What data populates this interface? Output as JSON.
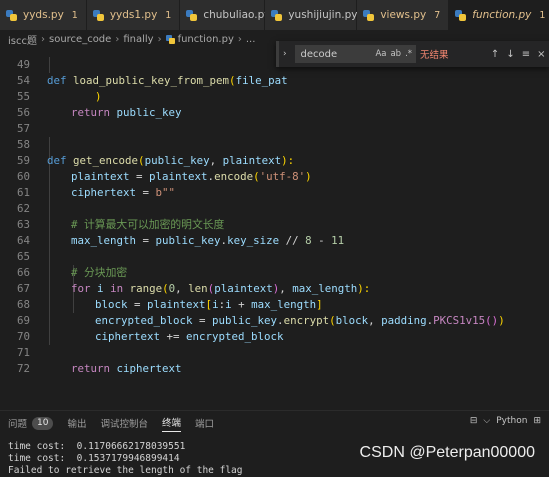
{
  "tabs": [
    {
      "name": "yyds.py",
      "badge": "1",
      "active": false
    },
    {
      "name": "yyds1.py",
      "badge": "1",
      "active": false
    },
    {
      "name": "chubuliao.py",
      "badge": "",
      "active": false
    },
    {
      "name": "yushijiujin.py",
      "badge": "",
      "active": false
    },
    {
      "name": "views.py",
      "badge": "7",
      "active": false
    },
    {
      "name": "function.py",
      "badge": "1",
      "active": true,
      "close": "×"
    }
  ],
  "breadcrumb": [
    "iscc题",
    "source_code",
    "finally",
    "function.py",
    "..."
  ],
  "find": {
    "query": "decode",
    "options": [
      "Aa",
      "ab",
      ".*"
    ],
    "status": "无结果",
    "buttons": [
      "↑",
      "↓",
      "≡",
      "×"
    ]
  },
  "code_lines": [
    {
      "n": "49",
      "indent": 0
    },
    {
      "n": "54",
      "indent": 1
    },
    {
      "n": "55",
      "indent": 1
    },
    {
      "n": "56",
      "indent": 0
    },
    {
      "n": "57",
      "indent": 0
    },
    {
      "n": "58",
      "indent": 0
    },
    {
      "n": "59",
      "indent": 1
    },
    {
      "n": "60",
      "indent": 1
    },
    {
      "n": "61",
      "indent": 1
    },
    {
      "n": "62",
      "indent": 1
    },
    {
      "n": "63",
      "indent": 1
    },
    {
      "n": "64",
      "indent": 1
    },
    {
      "n": "65",
      "indent": 1
    },
    {
      "n": "66",
      "indent": 1
    },
    {
      "n": "67",
      "indent": 2
    },
    {
      "n": "68",
      "indent": 2
    },
    {
      "n": "69",
      "indent": 2
    },
    {
      "n": "70",
      "indent": 1
    },
    {
      "n": "71",
      "indent": 1
    },
    {
      "n": "72",
      "indent": 0
    }
  ],
  "code_text": {
    "l49": [
      "def",
      "load_public_key_from_pem",
      "(",
      "file_pat"
    ],
    "l54": [
      ")"
    ],
    "l55": [
      "return",
      "public_key"
    ],
    "l58": [
      "def",
      "get_encode",
      "(",
      "public_key",
      ", ",
      "plaintext",
      "):"
    ],
    "l59": [
      "plaintext",
      " = ",
      "plaintext",
      ".",
      "encode",
      "(",
      "'utf-8'",
      ")"
    ],
    "l60": [
      "ciphertext",
      " = ",
      "b\"\""
    ],
    "l62": [
      "# 计算最大可以加密的明文长度"
    ],
    "l63": [
      "max_length",
      " = ",
      "public_key",
      ".",
      "key_size",
      " // ",
      "8",
      " - ",
      "11"
    ],
    "l65": [
      "# 分块加密"
    ],
    "l66": [
      "for",
      "i",
      "in",
      "range",
      "(",
      "0",
      ", ",
      "len",
      "(",
      "plaintext",
      ")",
      ", ",
      "max_length",
      "):"
    ],
    "l67": [
      "block",
      " = ",
      "plaintext",
      "[",
      "i",
      ":",
      "i",
      " + ",
      "max_length",
      "]"
    ],
    "l68": [
      "encrypted_block",
      " = ",
      "public_key",
      ".",
      "encrypt",
      "(",
      "block",
      ", ",
      "padding",
      ".",
      "PKCS1v15",
      "()",
      ")"
    ],
    "l69": [
      "ciphertext",
      " += ",
      "encrypted_block"
    ],
    "l71": [
      "return",
      "ciphertext"
    ]
  },
  "panel": {
    "tabs": [
      "问题",
      "输出",
      "调试控制台",
      "终端",
      "端口"
    ],
    "problems_count": "10",
    "active_tab": "终端",
    "right": [
      "⊟",
      "⌵",
      "Python",
      "⊞"
    ],
    "terminal_lines": [
      "time cost:  0.11706662178039551",
      "time cost:  0.1537179946899414",
      "Failed to retrieve the length of the flag"
    ]
  },
  "watermark": "CSDN @Peterpan00000",
  "colors": {
    "accent": "#e2c08d",
    "error": "#f48771",
    "background": "#1e1e1e"
  }
}
